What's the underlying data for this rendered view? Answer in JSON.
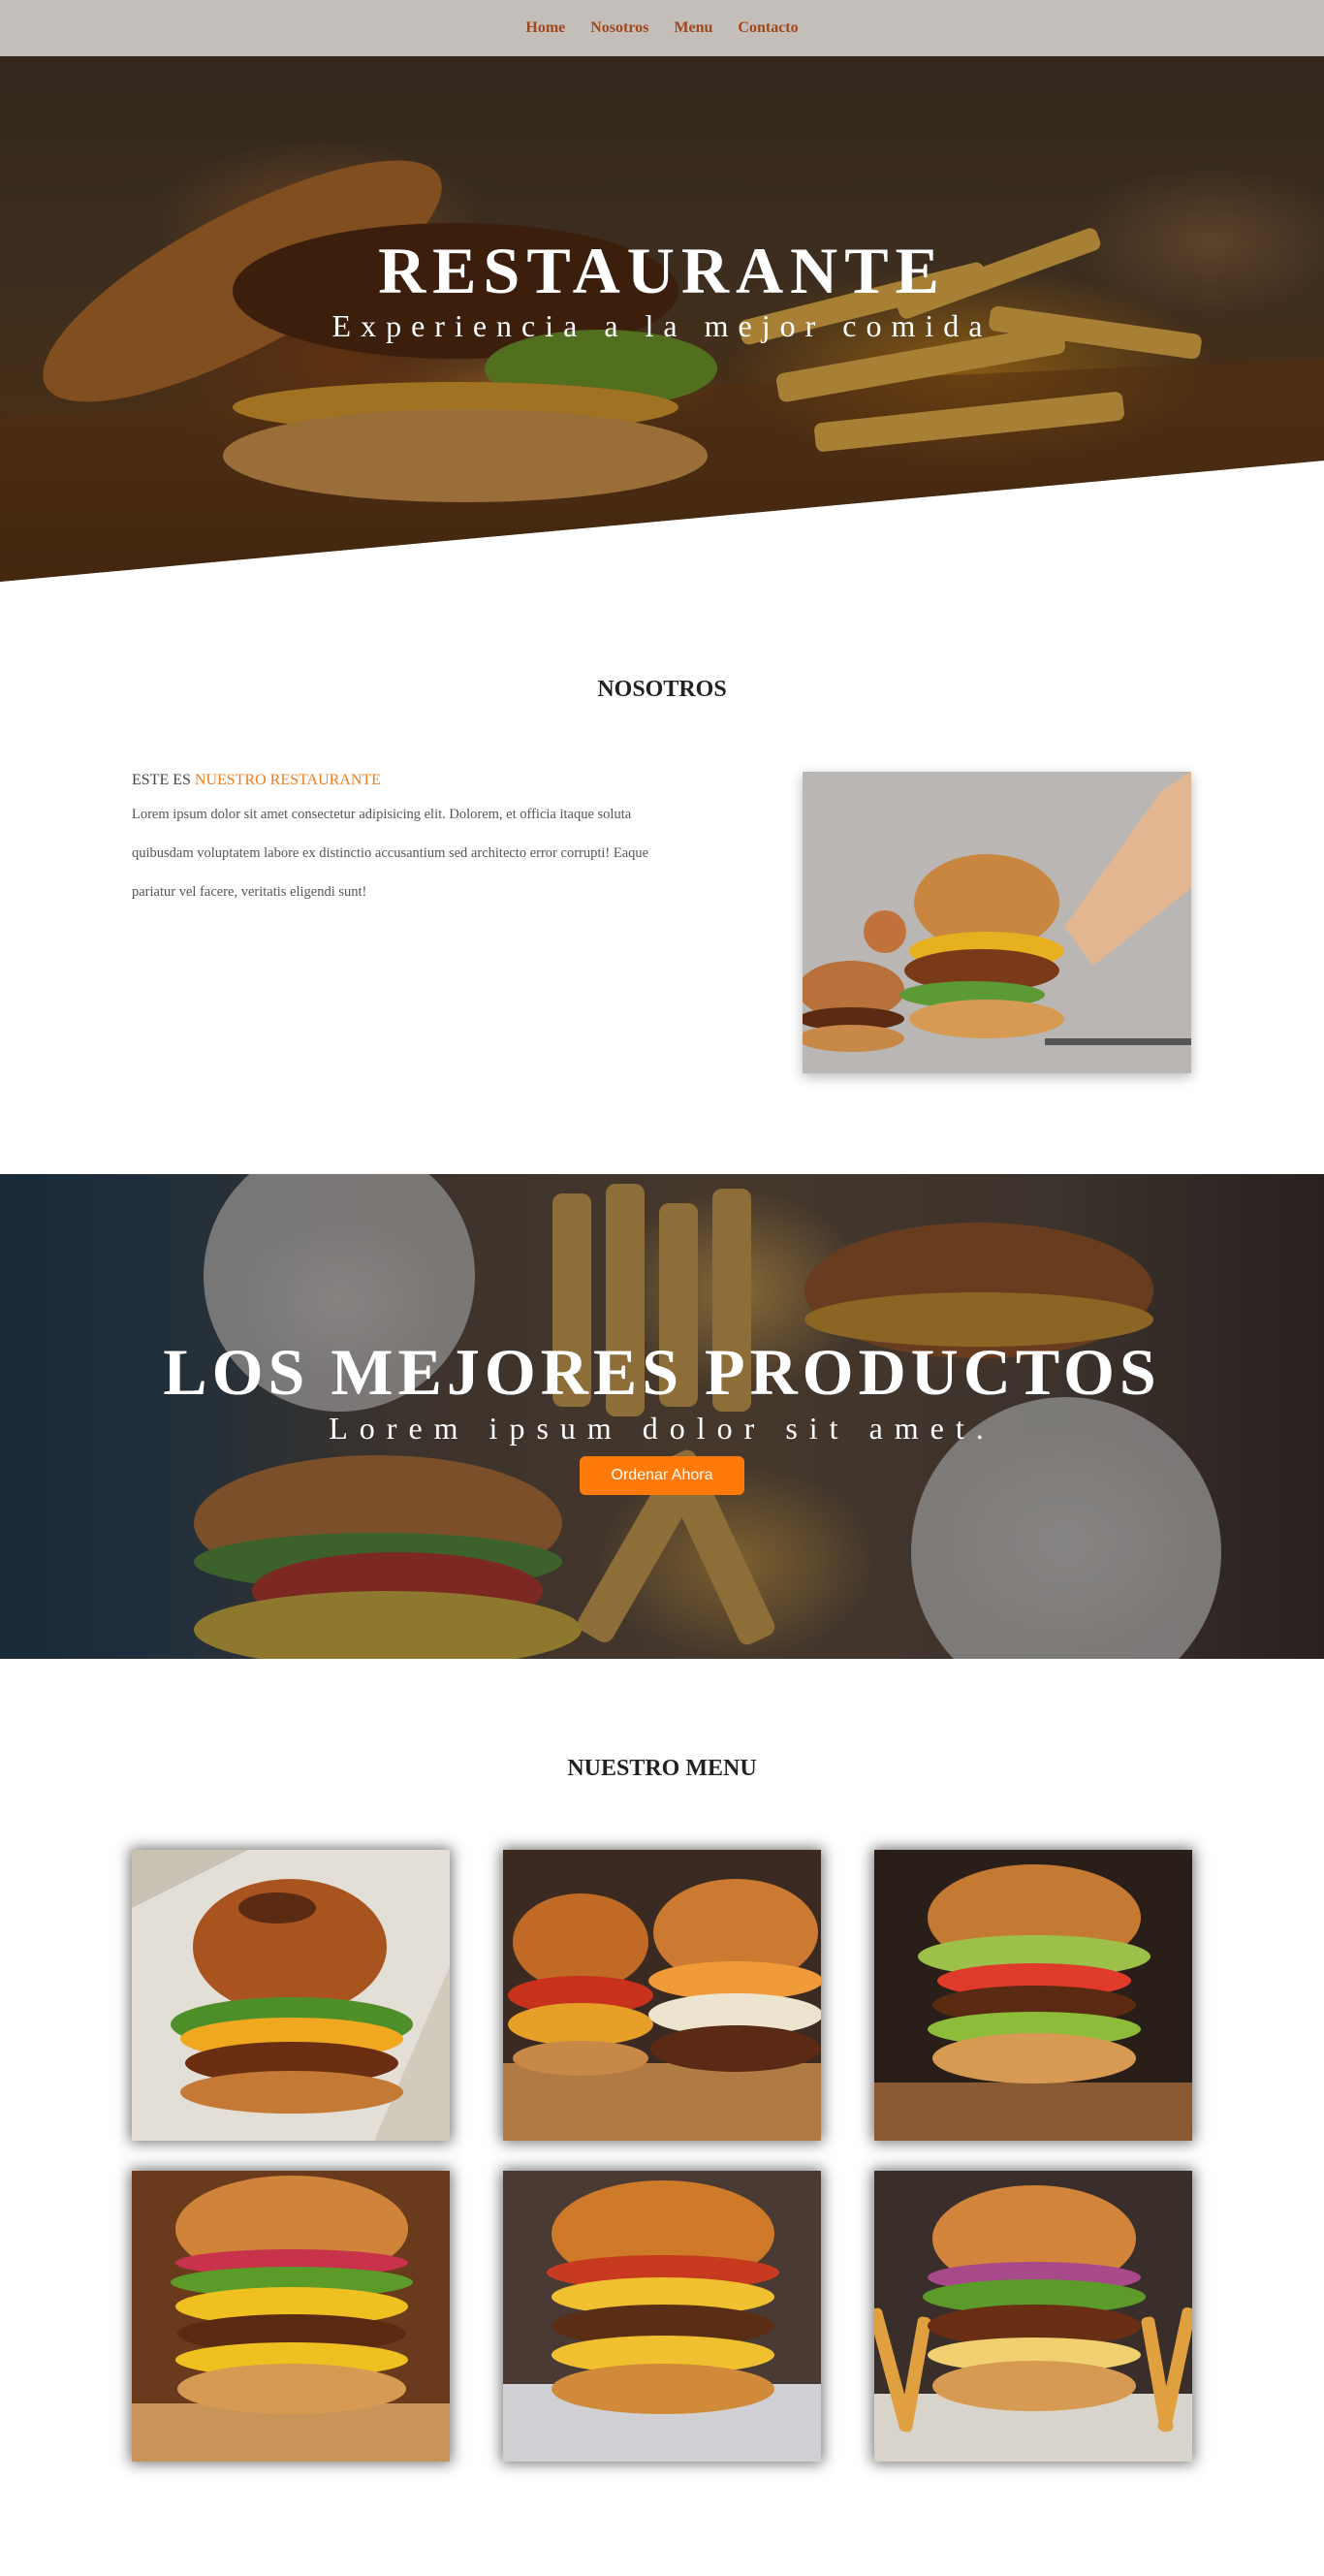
{
  "nav": {
    "items": [
      {
        "label": "Home"
      },
      {
        "label": "Nosotros"
      },
      {
        "label": "Menu"
      },
      {
        "label": "Contacto"
      }
    ],
    "link_color": "#a0481c"
  },
  "hero": {
    "title": "RESTAURANTE",
    "subtitle": "Experiencia a la mejor comida"
  },
  "about": {
    "section_title": "NOSOTROS",
    "heading_prefix": "ESTE ES",
    "heading_accent": "NUESTRO RESTAURANTE",
    "paragraph": "Lorem ipsum dolor sit amet consectetur adipisicing elit. Dolorem, et officia itaque soluta quibusdam voluptatem labore ex distinctio accusantium sed architecto error corrupti! Eaque pariatur vel facere, veritatis eligendi sunt!",
    "accent_color": "#f07c1a"
  },
  "banner": {
    "title": "LOS MEJORES PRODUCTOS",
    "subtitle": "Lorem ipsum dolor sit amet.",
    "button_label": "Ordenar Ahora",
    "button_color": "#ff7a0a"
  },
  "menu": {
    "section_title": "NUESTRO MENU",
    "items": [
      {
        "icon": "burger-photo"
      },
      {
        "icon": "burger-photo"
      },
      {
        "icon": "burger-photo"
      },
      {
        "icon": "burger-photo"
      },
      {
        "icon": "burger-photo"
      },
      {
        "icon": "burger-photo"
      }
    ]
  }
}
